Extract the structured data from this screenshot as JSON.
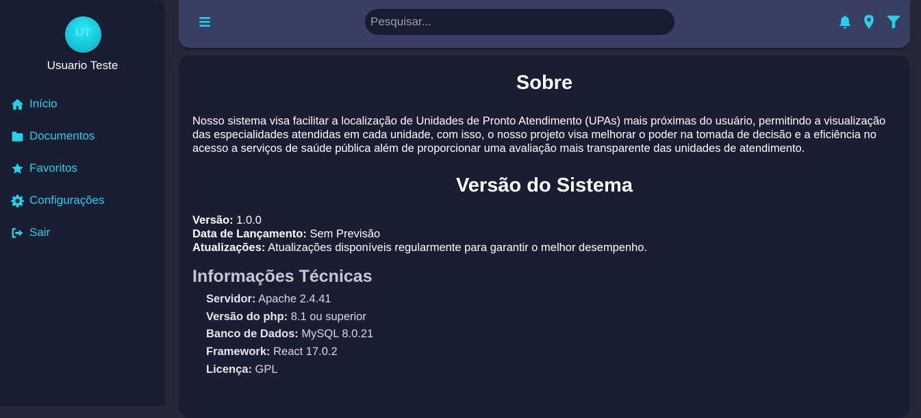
{
  "user": {
    "initials": "UT",
    "name": "Usuario Teste"
  },
  "sidebar": {
    "items": [
      {
        "label": "Início",
        "icon": "home-icon"
      },
      {
        "label": "Documentos",
        "icon": "folder-icon"
      },
      {
        "label": "Favoritos",
        "icon": "star-icon"
      },
      {
        "label": "Configurações",
        "icon": "gear-icon"
      },
      {
        "label": "Sair",
        "icon": "logout-icon"
      }
    ]
  },
  "topbar": {
    "search_placeholder": "Pesquisar...",
    "icons": [
      "menu-icon",
      "bell-icon",
      "location-pin-icon",
      "filter-icon"
    ]
  },
  "about": {
    "title": "Sobre",
    "text": "Nosso sistema visa facilitar a localização de Unidades de Pronto Atendimento (UPAs) mais próximas do usuário, permitindo a visualização das especialidades atendidas em cada unidade, com isso, o nosso projeto visa melhorar o poder na tomada de decisão e a eficiência no acesso a serviços de saúde pública além de proporcionar uma avaliação mais transparente das unidades de atendimento."
  },
  "version_section": {
    "title": "Versão do Sistema",
    "items": [
      {
        "label": "Versão:",
        "value": "1.0.0"
      },
      {
        "label": "Data de Lançamento:",
        "value": "Sem Previsão"
      },
      {
        "label": "Atualizações:",
        "value": "Atualizações disponíveis regularmente para garantir o melhor desempenho."
      }
    ]
  },
  "tech_section": {
    "title": "Informações Técnicas",
    "items": [
      {
        "label": "Servidor:",
        "value": "Apache 2.4.41"
      },
      {
        "label": "Versão do php:",
        "value": "8.1 ou superior"
      },
      {
        "label": "Banco de Dados:",
        "value": "MySQL 8.0.21"
      },
      {
        "label": "Framework:",
        "value": "React 17.0.2"
      },
      {
        "label": "Licença:",
        "value": "GPL"
      }
    ]
  },
  "colors": {
    "accent": "#22d2ea",
    "sidebar_bg": "#1b1d33",
    "topbar_bg": "#3b3e63",
    "page_bg": "#262838"
  }
}
